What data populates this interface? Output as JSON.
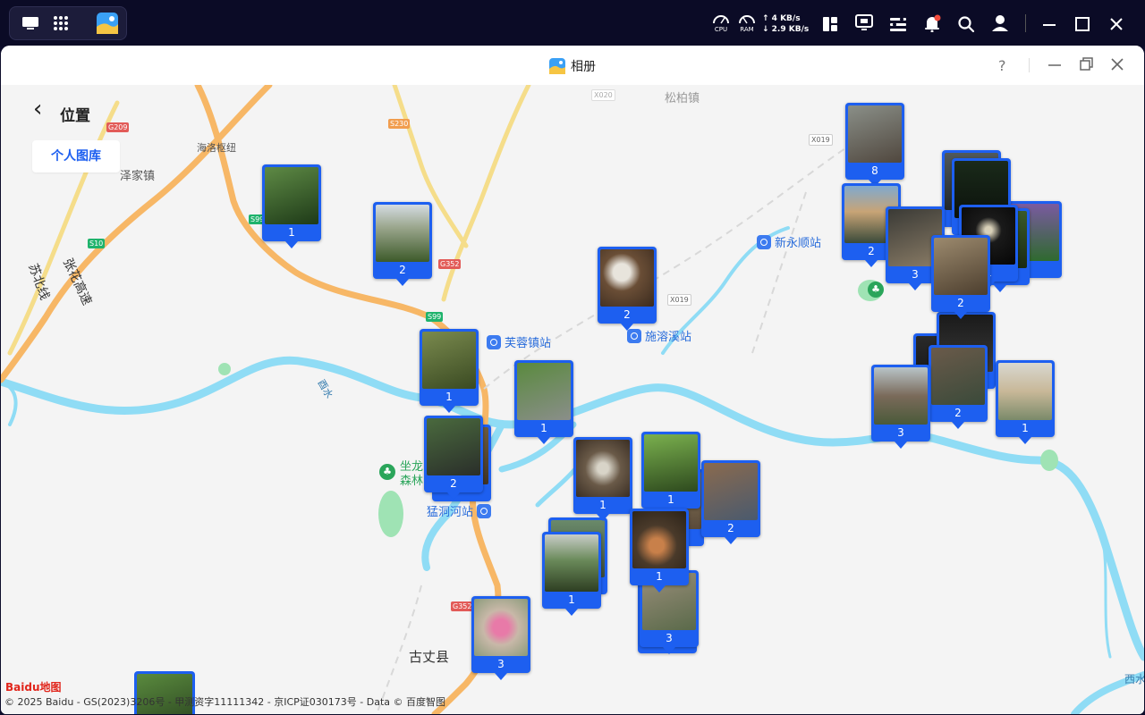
{
  "system": {
    "cpu_label": "CPU",
    "ram_label": "RAM",
    "upload": "↑ 4 KB/s",
    "download": "↓ 2.9 KB/s"
  },
  "window": {
    "title": "相册",
    "help": "?"
  },
  "page": {
    "back": "‹",
    "title": "位置",
    "library_button": "个人图库"
  },
  "map_labels": {
    "places": [
      "松柏镇",
      "海洛枢纽",
      "泽家镇",
      "古丈县",
      "酉水",
      "张花高速",
      "苏北线",
      "坐龙森林",
      "西水"
    ],
    "shields": [
      "G209",
      "S230",
      "S99",
      "S10",
      "G352",
      "S99",
      "X019",
      "X019",
      "X020",
      "G352"
    ],
    "stations": [
      "芙蓉镇站",
      "施溶溪站",
      "新永顺站",
      "猛洞河站"
    ]
  },
  "pins": [
    {
      "count": "8"
    },
    {
      "count": "1"
    },
    {
      "count": "2"
    },
    {
      "count": "2"
    },
    {
      "count": "2"
    },
    {
      "count": "3"
    },
    {
      "count": "1"
    },
    {
      "count": "1"
    },
    {
      "count": "2"
    },
    {
      "count": "1"
    },
    {
      "count": "2"
    },
    {
      "count": "1"
    },
    {
      "count": "1"
    },
    {
      "count": "2"
    },
    {
      "count": "1"
    },
    {
      "count": "1"
    },
    {
      "count": "3"
    },
    {
      "count": "3"
    },
    {
      "count": "2"
    },
    {
      "count": "3"
    },
    {
      "count": "1"
    },
    {
      "count": "1"
    }
  ],
  "footer": {
    "logo": "Baidu地图",
    "copyright": "© 2025 Baidu - GS(2023)3206号 - 甲测资字11111342 - 京ICP证030173号 - Data © 百度智图"
  },
  "colors": {
    "pin": "#1d5ff0",
    "river": "#8fdcf5",
    "road_major": "#f7b766",
    "road_minor": "#f5dd8a"
  }
}
